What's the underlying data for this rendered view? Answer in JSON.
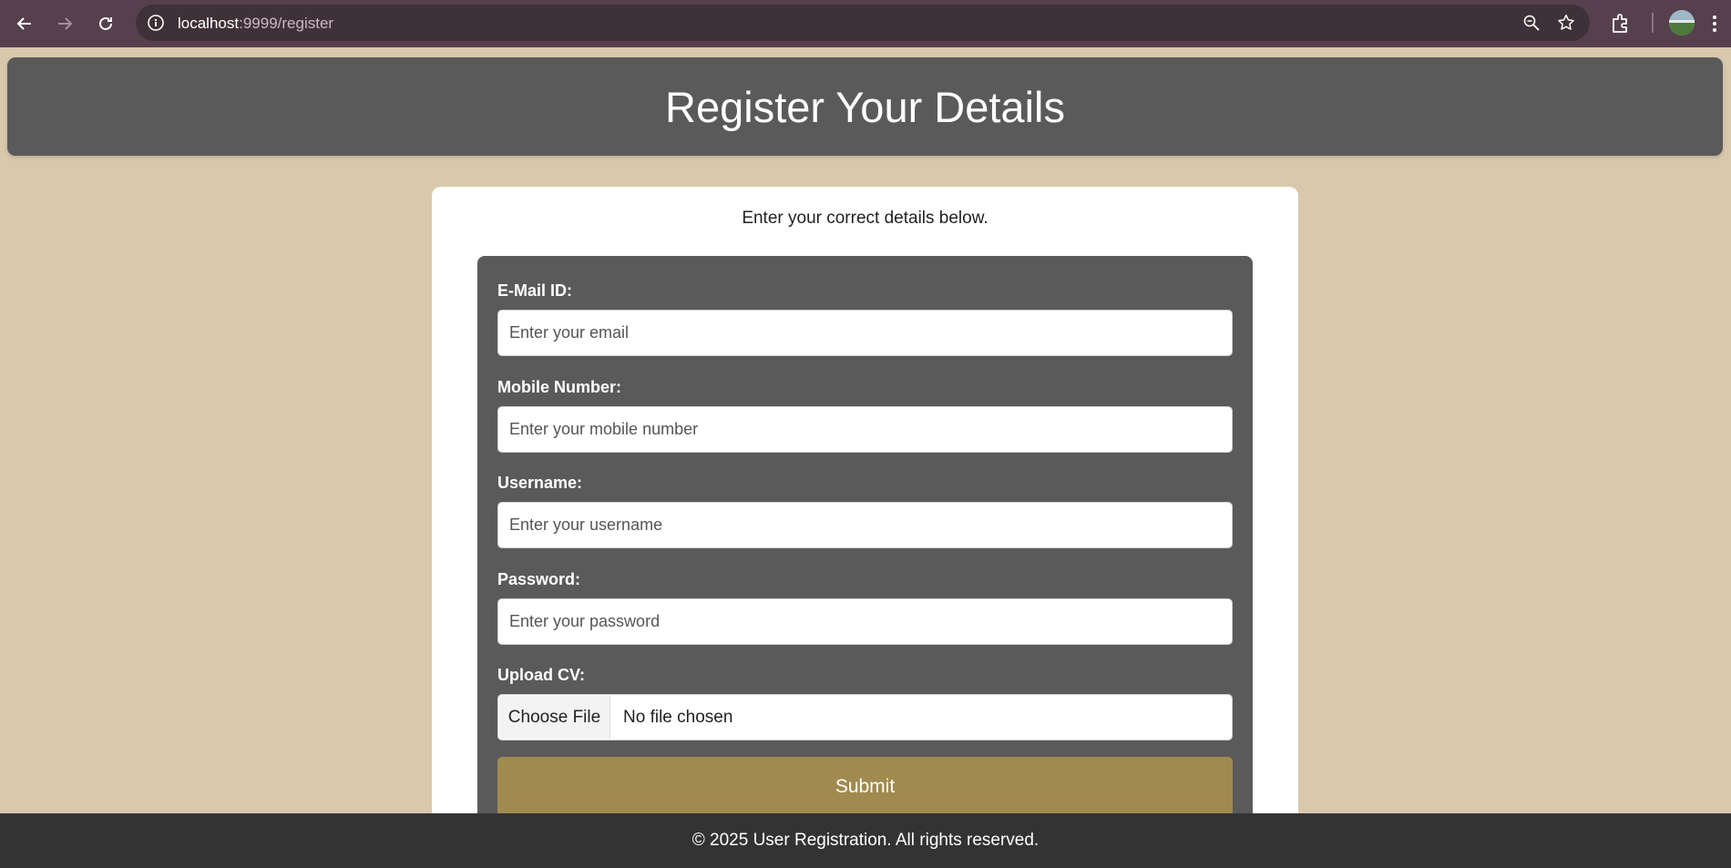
{
  "browser": {
    "url_host": "localhost",
    "url_rest": ":9999/register"
  },
  "page": {
    "title": "Register Your Details",
    "intro": "Enter your correct details below."
  },
  "form": {
    "fields": [
      {
        "label": "E-Mail ID:",
        "placeholder": "Enter your email",
        "value": ""
      },
      {
        "label": "Mobile Number:",
        "placeholder": "Enter your mobile number",
        "value": ""
      },
      {
        "label": "Username:",
        "placeholder": "Enter your username",
        "value": ""
      },
      {
        "label": "Password:",
        "placeholder": "Enter your password",
        "value": ""
      }
    ],
    "upload": {
      "label": "Upload CV:",
      "button": "Choose File",
      "status": "No file chosen"
    },
    "submit_label": "Submit"
  },
  "footer": {
    "text": "© 2025 User Registration. All rights reserved."
  },
  "colors": {
    "page_bg": "#d8c8ac",
    "header_bg": "#5a5a5a",
    "panel_bg": "#5a5a5a",
    "submit_bg": "#a08a4f",
    "footer_bg": "#333333",
    "browser_bar": "#56404e"
  },
  "icons": {
    "back": "arrow-left-icon",
    "forward": "arrow-right-icon",
    "reload": "reload-icon",
    "site_info": "info-icon",
    "zoom": "zoom-icon",
    "bookmark": "star-icon",
    "extensions": "puzzle-icon",
    "menu": "kebab-menu-icon"
  }
}
